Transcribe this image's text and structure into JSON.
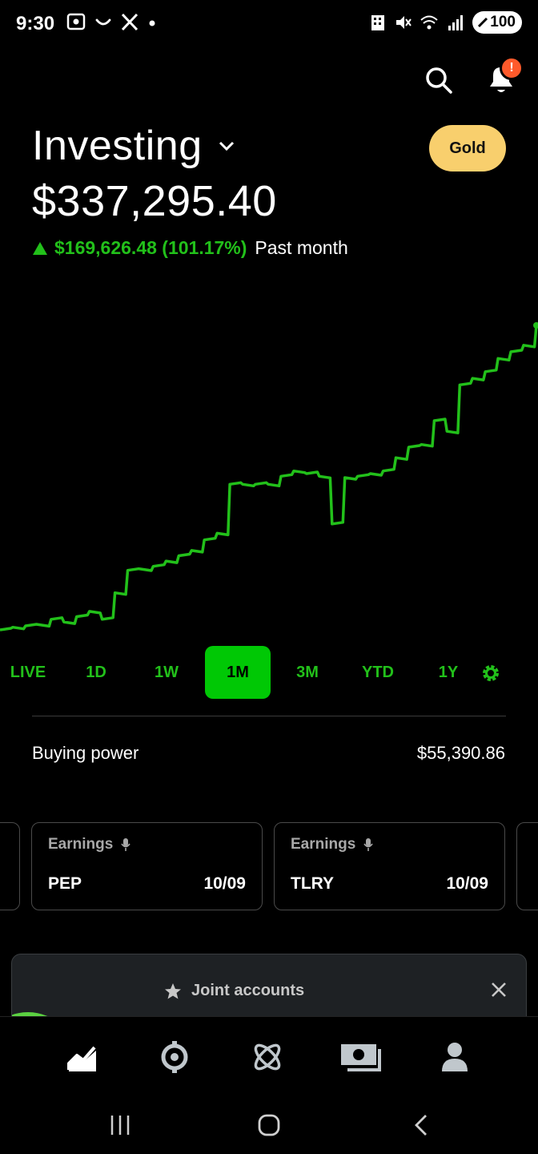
{
  "status_bar": {
    "time": "9:30",
    "battery": "100"
  },
  "header": {
    "title": "Investing",
    "gold_label": "Gold",
    "alert_badge": "!"
  },
  "portfolio": {
    "balance": "$337,295.40",
    "change": "$169,626.48 (101.17%)",
    "period": "Past month"
  },
  "chart_data": {
    "type": "line",
    "color": "#22c01a",
    "series": [
      {
        "values": [
          0,
          2,
          3,
          4,
          8,
          6,
          10,
          14,
          8,
          28,
          45,
          46,
          48,
          52,
          56,
          60,
          68,
          73,
          110,
          110,
          110,
          110,
          116,
          120,
          118,
          116,
          80,
          115,
          116,
          118,
          120,
          130,
          138,
          140,
          158,
          150,
          185,
          190,
          195,
          205,
          210,
          215,
          230
        ]
      }
    ]
  },
  "ranges": {
    "items": [
      "LIVE",
      "1D",
      "1W",
      "1M",
      "3M",
      "YTD",
      "1Y"
    ],
    "active": "1M"
  },
  "buying_power": {
    "label": "Buying power",
    "value": "$55,390.86"
  },
  "cards": [
    {
      "tag": "Earnings",
      "symbol": "PEP",
      "date": "10/09"
    },
    {
      "tag": "Earnings",
      "symbol": "TLRY",
      "date": "10/09"
    }
  ],
  "promo": {
    "title": "Joint accounts"
  },
  "icons": {
    "status": [
      "screenshot-icon",
      "smile-icon",
      "x-logo-icon",
      "dot-icon",
      "building-icon",
      "mute-icon",
      "wifi-icon",
      "signal-icon",
      "battery-icon"
    ],
    "nav": [
      "chart-icon",
      "crypto-icon",
      "orbit-icon",
      "cash-icon",
      "profile-icon"
    ]
  }
}
